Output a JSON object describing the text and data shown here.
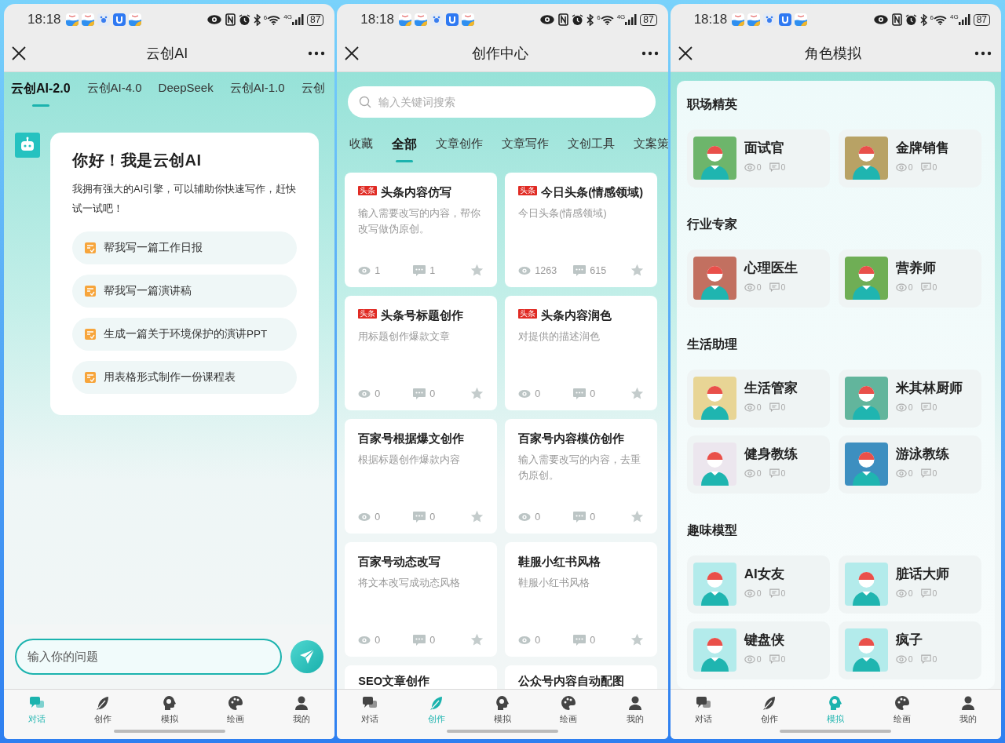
{
  "screens": [
    {
      "kind": "chat",
      "status_bar": {
        "time": "18:18",
        "wifi": "6",
        "network": "4G",
        "battery": "87"
      },
      "title": "云创AI",
      "model_tabs": [
        {
          "label": "云创AI-2.0",
          "selected": true
        },
        {
          "label": "云创AI-4.0",
          "selected": false
        },
        {
          "label": "DeepSeek",
          "selected": false
        },
        {
          "label": "云创AI-1.0",
          "selected": false
        },
        {
          "label": "云创",
          "selected": false
        }
      ],
      "greeting": {
        "title": "你好！我是云创AI",
        "body": "我拥有强大的AI引擎，可以辅助你快速写作，赶快试一试吧！",
        "suggestions": [
          "帮我写一篇工作日报",
          "帮我写一篇演讲稿",
          "生成一篇关于环境保护的演讲PPT",
          "用表格形式制作一份课程表"
        ]
      },
      "input": {
        "placeholder": "输入你的问题"
      },
      "nav": [
        {
          "kind": "chat",
          "label": "对话",
          "selected": true
        },
        {
          "kind": "feather",
          "label": "创作",
          "selected": false
        },
        {
          "kind": "head",
          "label": "模拟",
          "selected": false
        },
        {
          "kind": "palette",
          "label": "绘画",
          "selected": false
        },
        {
          "kind": "person",
          "label": "我的",
          "selected": false
        }
      ]
    },
    {
      "kind": "create",
      "status_bar": {
        "time": "18:18",
        "wifi": "6",
        "network": "4G",
        "battery": "87"
      },
      "title": "创作中心",
      "search": {
        "placeholder": "输入关键词搜索"
      },
      "category_tabs": [
        {
          "label": "收藏",
          "selected": false
        },
        {
          "label": "全部",
          "selected": true
        },
        {
          "label": "文章创作",
          "selected": false
        },
        {
          "label": "文章写作",
          "selected": false
        },
        {
          "label": "文创工具",
          "selected": false
        },
        {
          "label": "文案策",
          "selected": false
        }
      ],
      "cards": [
        {
          "badge": "头条",
          "title": "头条内容仿写",
          "description": "输入需要改写的内容，帮你改写做伪原创。",
          "views": "1",
          "comments": "1",
          "starred": false
        },
        {
          "badge": "头条",
          "title": "今日头条(情感领域)",
          "description": "今日头条(情感领域)",
          "views": "1263",
          "comments": "615",
          "starred": false
        },
        {
          "badge": "头条",
          "title": "头条号标题创作",
          "description": "用标题创作爆款文章",
          "views": "0",
          "comments": "0",
          "starred": false
        },
        {
          "badge": "头条",
          "title": "头条内容润色",
          "description": "对提供的描述润色",
          "views": "0",
          "comments": "0",
          "starred": false
        },
        {
          "title": "百家号根据爆文创作",
          "description": "根据标题创作爆款内容",
          "views": "0",
          "comments": "0",
          "starred": false
        },
        {
          "title": "百家号内容模仿创作",
          "description": "输入需要改写的内容，去重伪原创。",
          "views": "0",
          "comments": "0",
          "starred": false
        },
        {
          "title": "百家号动态改写",
          "description": "将文本改写成动态风格",
          "views": "0",
          "comments": "0",
          "starred": false
        },
        {
          "title": "鞋服小红书风格",
          "description": "鞋服小红书风格",
          "views": "0",
          "comments": "0",
          "starred": false
        },
        {
          "title": "SEO文章创作"
        },
        {
          "title": "公众号内容自动配图"
        }
      ],
      "nav": [
        {
          "kind": "chat",
          "label": "对话",
          "selected": false
        },
        {
          "kind": "feather",
          "label": "创作",
          "selected": true
        },
        {
          "kind": "head",
          "label": "模拟",
          "selected": false
        },
        {
          "kind": "palette",
          "label": "绘画",
          "selected": false
        },
        {
          "kind": "person",
          "label": "我的",
          "selected": false
        }
      ]
    },
    {
      "kind": "roles",
      "status_bar": {
        "time": "18:18",
        "wifi": "6",
        "network": "4G",
        "battery": "87"
      },
      "title": "角色模拟",
      "sections": [
        {
          "title": "职场精英",
          "roles": [
            {
              "name": "面试官",
              "color": "#6db56b",
              "views": "0",
              "comments": "0"
            },
            {
              "name": "金牌销售",
              "color": "#b8a265",
              "views": "0",
              "comments": "0"
            }
          ]
        },
        {
          "title": "行业专家",
          "roles": [
            {
              "name": "心理医生",
              "color": "#c27060",
              "views": "0",
              "comments": "0"
            },
            {
              "name": "营养师",
              "color": "#6fae55",
              "views": "0",
              "comments": "0"
            }
          ]
        },
        {
          "title": "生活助理",
          "roles": [
            {
              "name": "生活管家",
              "color": "#e8d595",
              "views": "0",
              "comments": "0"
            },
            {
              "name": "米其林厨师",
              "color": "#62b59c",
              "views": "0",
              "comments": "0"
            },
            {
              "name": "健身教练",
              "color": "#ece6ee",
              "views": "0",
              "comments": "0"
            },
            {
              "name": "游泳教练",
              "color": "#3d8fc0",
              "views": "0",
              "comments": "0"
            }
          ]
        },
        {
          "title": "趣味模型",
          "roles": [
            {
              "name": "AI女友",
              "color": "#b3ebeb",
              "views": "0",
              "comments": "0"
            },
            {
              "name": "脏话大师",
              "color": "#b3ebeb",
              "views": "0",
              "comments": "0"
            },
            {
              "name": "键盘侠",
              "color": "#b3ebeb",
              "views": "0",
              "comments": "0"
            },
            {
              "name": "疯子",
              "color": "#b3ebeb",
              "views": "0",
              "comments": "0"
            }
          ]
        }
      ],
      "nav": [
        {
          "kind": "chat",
          "label": "对话",
          "selected": false
        },
        {
          "kind": "feather",
          "label": "创作",
          "selected": false
        },
        {
          "kind": "head",
          "label": "模拟",
          "selected": true
        },
        {
          "kind": "palette",
          "label": "绘画",
          "selected": false
        },
        {
          "kind": "person",
          "label": "我的",
          "selected": false
        }
      ]
    }
  ]
}
